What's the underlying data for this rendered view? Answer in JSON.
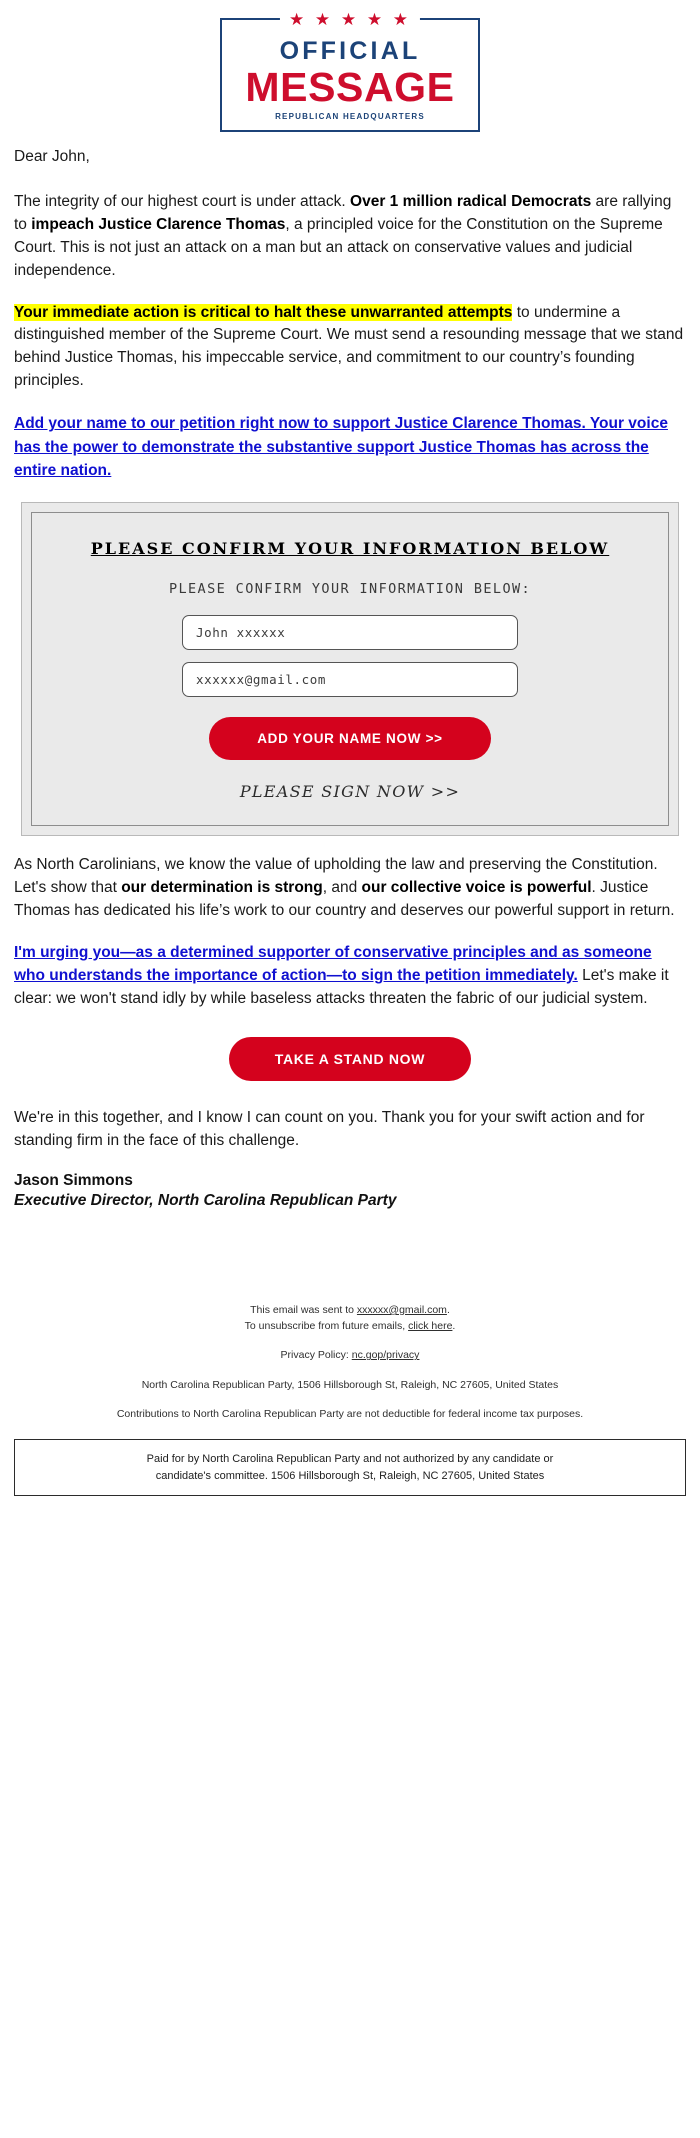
{
  "logo": {
    "stars": "★ ★ ★ ★ ★",
    "official": "OFFICIAL",
    "message": "MESSAGE",
    "headquarters": "REPUBLICAN HEADQUARTERS",
    "blue": "#1c4378",
    "red": "#ce0e2d"
  },
  "letter": {
    "salutation": "Dear John,",
    "p1_a": "The integrity of our highest court is under attack. ",
    "p1_b": "Over 1 million radical Democrats",
    "p1_c": " are rallying to ",
    "p1_d": "impeach Justice Clarence Thomas",
    "p1_e": ", a principled voice for the Constitution on the Supreme Court. This is not just an attack on a man but an attack on conservative values and judicial independence.",
    "p2_hl": "Your immediate action is critical to halt these unwarranted attempts",
    "p2_rest": " to undermine a distinguished member of the Supreme Court. We must send a resounding message that we stand behind Justice Thomas, his impeccable service, and commitment to our country’s founding principles.",
    "link1": "Add your name to our petition right now to support Justice Clarence Thomas. Your voice has the power to demonstrate the substantive support Justice Thomas has across the entire nation.",
    "p3_a": "As North Carolinians, we know the value of upholding the law and preserving the Constitution. Let's show that ",
    "p3_b": "our determination is strong",
    "p3_c": ", and ",
    "p3_d": "our collective voice is powerful",
    "p3_e": ". Justice Thomas has dedicated his life’s work to our country and deserves our powerful support in return.",
    "link2": "I'm urging you—as a determined supporter of conservative principles and as someone who understands the importance of action—to sign the petition immediately.",
    "p4_rest": " Let's make it clear: we won't stand idly by while baseless attacks threaten the fabric of our judicial system.",
    "p5": "We're in this together, and I know I can count on you. Thank you for your swift action and for standing firm in the face of this challenge."
  },
  "form": {
    "title": "PLEASE CONFIRM YOUR INFORMATION BELOW",
    "subtitle": "PLEASE CONFIRM YOUR INFORMATION BELOW:",
    "name_value": "John xxxxxx",
    "name_placeholder": "John xxxxxx",
    "email_value": "xxxxxx@gmail.com",
    "email_placeholder": "xxxxxx@gmail.com",
    "submit_label": "ADD YOUR NAME NOW >>",
    "sign_now": "PLEASE SIGN NOW >>",
    "button_color": "#d4021d"
  },
  "cta": {
    "take_a_stand_label": "TAKE A STAND NOW"
  },
  "signature": {
    "name": "Jason Simmons",
    "title": "Executive Director, North Carolina Republican Party"
  },
  "footer": {
    "sent_to_prefix": "This email was sent to ",
    "sent_to_email": "xxxxxx@gmail.com",
    "sent_to_suffix": ".",
    "unsubscribe_prefix": "To unsubscribe from future emails, ",
    "unsubscribe_link": "click here",
    "unsubscribe_suffix": ".",
    "privacy_prefix": "Privacy Policy: ",
    "privacy_link": "nc.gop/privacy",
    "address": "North Carolina Republican Party, 1506 Hillsborough St, Raleigh, NC 27605, United States",
    "contributions": "Contributions to North Carolina Republican Party are not deductible for federal income tax purposes.",
    "disclaimer_line1": "Paid for by North Carolina Republican Party and not authorized by any candidate or",
    "disclaimer_line2": "candidate's committee. 1506 Hillsborough St, Raleigh, NC 27605, United States"
  }
}
